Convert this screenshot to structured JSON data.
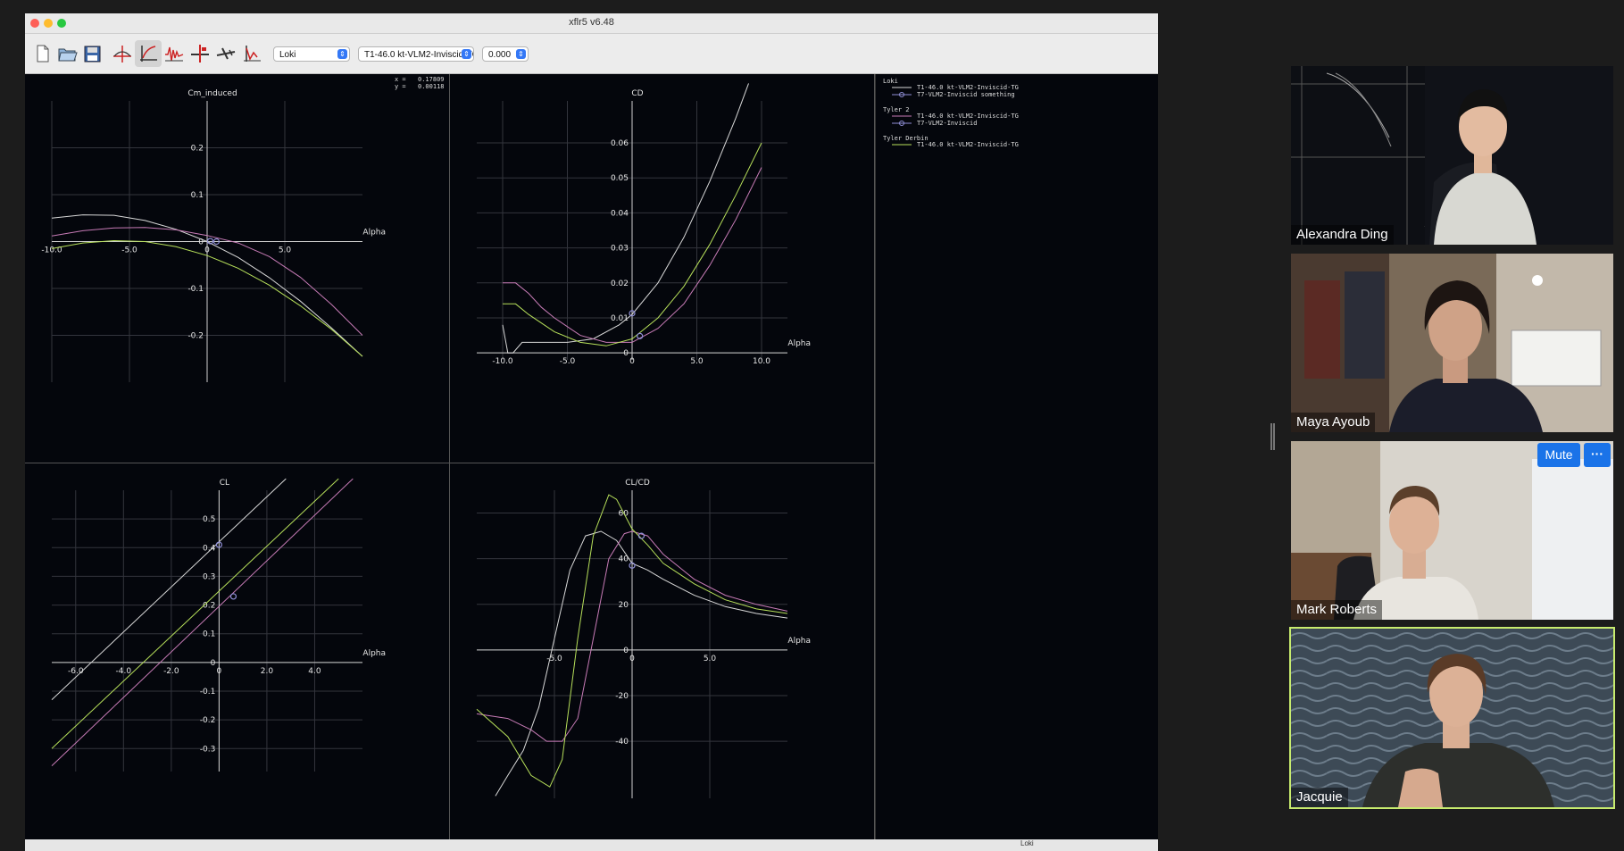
{
  "window": {
    "title": "xflr5 v6.48",
    "traffic_colors": [
      "#fe5f57",
      "#febc2e",
      "#28c840"
    ]
  },
  "toolbar": {
    "buttons": [
      {
        "name": "new-file",
        "icon": "new-document-icon"
      },
      {
        "name": "open-file",
        "icon": "open-folder-icon"
      },
      {
        "name": "save-file",
        "icon": "save-disk-icon"
      },
      {
        "name": "airfoil-design",
        "icon": "airfoil-icon"
      },
      {
        "name": "polar-view",
        "icon": "polar-icon"
      },
      {
        "name": "opp-view",
        "icon": "waveform-icon"
      },
      {
        "name": "cp-view",
        "icon": "cp-icon"
      },
      {
        "name": "3d-view",
        "icon": "plane-3d-icon"
      },
      {
        "name": "stability-view",
        "icon": "stability-icon"
      }
    ],
    "plane_select": "Loki",
    "polar_select": "T1-46.0 kt-VLM2-Inviscid-TG",
    "alpha_select": "0.000"
  },
  "readout": {
    "x_label": "x =",
    "x_value": "0.17809",
    "y_label": "y =",
    "y_value": "0.00118"
  },
  "legend": {
    "groups": [
      {
        "name": "Loki",
        "entries": [
          {
            "label": "T1-46.0 kt-VLM2-Inviscid-TG",
            "color": "#d8d8d8",
            "marker": false
          },
          {
            "label": "T7-VLM2-Inviscid something",
            "color": "#8f8fd6",
            "marker": true
          }
        ]
      },
      {
        "name": "Tyler 2",
        "entries": [
          {
            "label": "T1-46.0 kt-VLM2-Inviscid-TG",
            "color": "#c77bb6",
            "marker": false
          },
          {
            "label": "T7-VLM2-Inviscid",
            "color": "#8f8fd6",
            "marker": true
          }
        ]
      },
      {
        "name": "Tyler Derbin",
        "entries": [
          {
            "label": "T1-46.0 kt-VLM2-Inviscid-TG",
            "color": "#b7e05a",
            "marker": false
          }
        ]
      }
    ]
  },
  "chart_data": [
    {
      "type": "line",
      "title": "Cm_induced",
      "xlabel": "Alpha",
      "ylabel": "",
      "xlim": [
        -10,
        10
      ],
      "ylim": [
        -0.3,
        0.3
      ],
      "xticks": [
        {
          "v": -10,
          "t": "-10.0"
        },
        {
          "v": -5,
          "t": "-5.0"
        },
        {
          "v": 0,
          "t": "0"
        },
        {
          "v": 5,
          "t": "5.0"
        }
      ],
      "yticks": [
        {
          "v": 0.2,
          "t": "0.2"
        },
        {
          "v": 0.1,
          "t": "0.1"
        },
        {
          "v": 0,
          "t": "0"
        },
        {
          "v": -0.1,
          "t": "-0.1"
        },
        {
          "v": -0.2,
          "t": "-0.2"
        }
      ],
      "series": [
        {
          "color": "#d8d8d8",
          "x": [
            -10,
            -8,
            -6,
            -4,
            -2,
            0,
            2,
            4,
            6,
            8,
            10
          ],
          "y": [
            0.05,
            0.057,
            0.056,
            0.045,
            0.026,
            0.0,
            -0.034,
            -0.077,
            -0.127,
            -0.184,
            -0.245
          ]
        },
        {
          "color": "#c77bb6",
          "x": [
            -10,
            -8,
            -6,
            -4,
            -2,
            0,
            2,
            4,
            6,
            8,
            10
          ],
          "y": [
            0.012,
            0.023,
            0.029,
            0.03,
            0.025,
            0.013,
            -0.003,
            -0.032,
            -0.076,
            -0.134,
            -0.2
          ]
        },
        {
          "color": "#b7e05a",
          "x": [
            -10,
            -8,
            -6,
            -4,
            -2,
            0,
            2,
            4,
            6,
            8,
            10
          ],
          "y": [
            -0.015,
            -0.003,
            0.002,
            0.0,
            -0.011,
            -0.03,
            -0.057,
            -0.093,
            -0.137,
            -0.187,
            -0.245
          ]
        }
      ],
      "points": [
        {
          "x": 0.2,
          "y": 0.001,
          "color": "#8f8fd6"
        },
        {
          "x": 0.6,
          "y": 0.0,
          "color": "#8f8fd6"
        }
      ]
    },
    {
      "type": "line",
      "title": "CD",
      "xlabel": "Alpha",
      "ylabel": "",
      "xlim": [
        -12,
        12
      ],
      "ylim": [
        -0.002,
        0.072
      ],
      "xticks": [
        {
          "v": -10,
          "t": "-10.0"
        },
        {
          "v": -5,
          "t": "-5.0"
        },
        {
          "v": 0,
          "t": "0"
        },
        {
          "v": 5,
          "t": "5.0"
        },
        {
          "v": 10,
          "t": "10.0"
        }
      ],
      "yticks": [
        {
          "v": 0.06,
          "t": "0.06"
        },
        {
          "v": 0.05,
          "t": "0.05"
        },
        {
          "v": 0.04,
          "t": "0.04"
        },
        {
          "v": 0.03,
          "t": "0.03"
        },
        {
          "v": 0.02,
          "t": "0.02"
        },
        {
          "v": 0.01,
          "t": "0.01"
        },
        {
          "v": 0,
          "t": "0"
        }
      ],
      "series": [
        {
          "color": "#d8d8d8",
          "x": [
            -10.0,
            -9.6,
            -9.2,
            -8.5,
            -7,
            -5,
            -3,
            -1,
            0,
            2,
            4,
            6,
            8,
            9
          ],
          "y": [
            0.008,
            0.0,
            0.0,
            0.003,
            0.003,
            0.003,
            0.004,
            0.008,
            0.011,
            0.02,
            0.033,
            0.049,
            0.067,
            0.077
          ]
        },
        {
          "color": "#c77bb6",
          "x": [
            -10,
            -9,
            -8,
            -7,
            -6,
            -4,
            -2,
            0,
            2,
            4,
            6,
            8,
            10
          ],
          "y": [
            0.02,
            0.02,
            0.017,
            0.013,
            0.01,
            0.005,
            0.003,
            0.003,
            0.007,
            0.014,
            0.025,
            0.038,
            0.053
          ]
        },
        {
          "color": "#b7e05a",
          "x": [
            -10,
            -9,
            -8,
            -6,
            -4,
            -2,
            0,
            2,
            4,
            6,
            8,
            10
          ],
          "y": [
            0.014,
            0.014,
            0.011,
            0.006,
            0.003,
            0.002,
            0.004,
            0.01,
            0.019,
            0.031,
            0.045,
            0.06
          ]
        }
      ],
      "points": [
        {
          "x": 0,
          "y": 0.0113,
          "color": "#8f8fd6"
        },
        {
          "x": 0.6,
          "y": 0.0048,
          "color": "#8f8fd6"
        }
      ]
    },
    {
      "type": "line",
      "title": "CL",
      "xlabel": "Alpha",
      "ylabel": "",
      "xlim": [
        -7,
        6
      ],
      "ylim": [
        -0.38,
        0.6
      ],
      "xticks": [
        {
          "v": -6,
          "t": "-6.0"
        },
        {
          "v": -4,
          "t": "-4.0"
        },
        {
          "v": -2,
          "t": "-2.0"
        },
        {
          "v": 0,
          "t": "0"
        },
        {
          "v": 2,
          "t": "2.0"
        },
        {
          "v": 4,
          "t": "4.0"
        }
      ],
      "yticks": [
        {
          "v": 0.5,
          "t": "0.5"
        },
        {
          "v": 0.4,
          "t": "0.4"
        },
        {
          "v": 0.3,
          "t": "0.3"
        },
        {
          "v": 0.2,
          "t": "0.2"
        },
        {
          "v": 0.1,
          "t": "0.1"
        },
        {
          "v": 0,
          "t": "0"
        },
        {
          "v": -0.1,
          "t": "-0.1"
        },
        {
          "v": -0.2,
          "t": "-0.2"
        },
        {
          "v": -0.3,
          "t": "-0.3"
        }
      ],
      "series": [
        {
          "color": "#d8d8d8",
          "x": [
            -7,
            2.8
          ],
          "y": [
            -0.13,
            0.64
          ]
        },
        {
          "color": "#b7e05a",
          "x": [
            -7,
            5
          ],
          "y": [
            -0.3,
            0.64
          ]
        },
        {
          "color": "#c77bb6",
          "x": [
            -7,
            5.6
          ],
          "y": [
            -0.36,
            0.64
          ]
        }
      ],
      "points": [
        {
          "x": 0,
          "y": 0.41,
          "color": "#8f8fd6"
        },
        {
          "x": 0.6,
          "y": 0.23,
          "color": "#8f8fd6"
        }
      ]
    },
    {
      "type": "line",
      "title": "CL/CD",
      "xlabel": "Alpha",
      "ylabel": "",
      "xlim": [
        -10,
        10
      ],
      "ylim": [
        -65,
        70
      ],
      "xticks": [
        {
          "v": -5,
          "t": "-5.0"
        },
        {
          "v": 0,
          "t": "0"
        },
        {
          "v": 5,
          "t": "5.0"
        }
      ],
      "yticks": [
        {
          "v": 60,
          "t": "60"
        },
        {
          "v": 40,
          "t": "40"
        },
        {
          "v": 20,
          "t": "20"
        },
        {
          "v": 0,
          "t": "0"
        },
        {
          "v": -20,
          "t": "-20"
        },
        {
          "v": -40,
          "t": "-40"
        }
      ],
      "series": [
        {
          "color": "#d8d8d8",
          "x": [
            -8.8,
            -8,
            -7,
            -6,
            -5,
            -4,
            -3,
            -2,
            -1,
            0,
            1,
            2,
            4,
            6,
            8,
            10
          ],
          "y": [
            -64,
            -55,
            -44,
            -25,
            5,
            35,
            50,
            52,
            48,
            38,
            35,
            31,
            24,
            19,
            16,
            14
          ]
        },
        {
          "color": "#c77bb6",
          "x": [
            -10,
            -8,
            -6.5,
            -5.5,
            -4.5,
            -3.5,
            -2.5,
            -1.5,
            -0.5,
            0,
            1,
            2,
            4,
            6,
            8,
            10
          ],
          "y": [
            -28,
            -30,
            -35,
            -40,
            -40,
            -30,
            5,
            40,
            51,
            52,
            50,
            42,
            31,
            24,
            20,
            17
          ]
        },
        {
          "color": "#b7e05a",
          "x": [
            -10,
            -8,
            -6.5,
            -5.3,
            -4.5,
            -3.5,
            -2.5,
            -1.5,
            -1,
            0,
            1,
            2,
            4,
            6,
            8,
            10
          ],
          "y": [
            -26,
            -38,
            -55,
            -60,
            -48,
            5,
            50,
            68,
            66,
            53,
            46,
            38,
            29,
            22,
            18,
            16
          ]
        }
      ],
      "points": [
        {
          "x": 0,
          "y": 37,
          "color": "#8f8fd6"
        },
        {
          "x": 0.6,
          "y": 50,
          "color": "#8f8fd6"
        }
      ]
    }
  ],
  "participants": [
    {
      "name": "Alexandra Ding",
      "active": false
    },
    {
      "name": "Maya Ayoub",
      "active": false
    },
    {
      "name": "Mark Roberts",
      "active": false
    },
    {
      "name": "Jacquie",
      "active": true
    }
  ],
  "controls": {
    "mute_label": "Mute",
    "more_label": "···"
  },
  "statusbar": {
    "text": "Loki"
  }
}
